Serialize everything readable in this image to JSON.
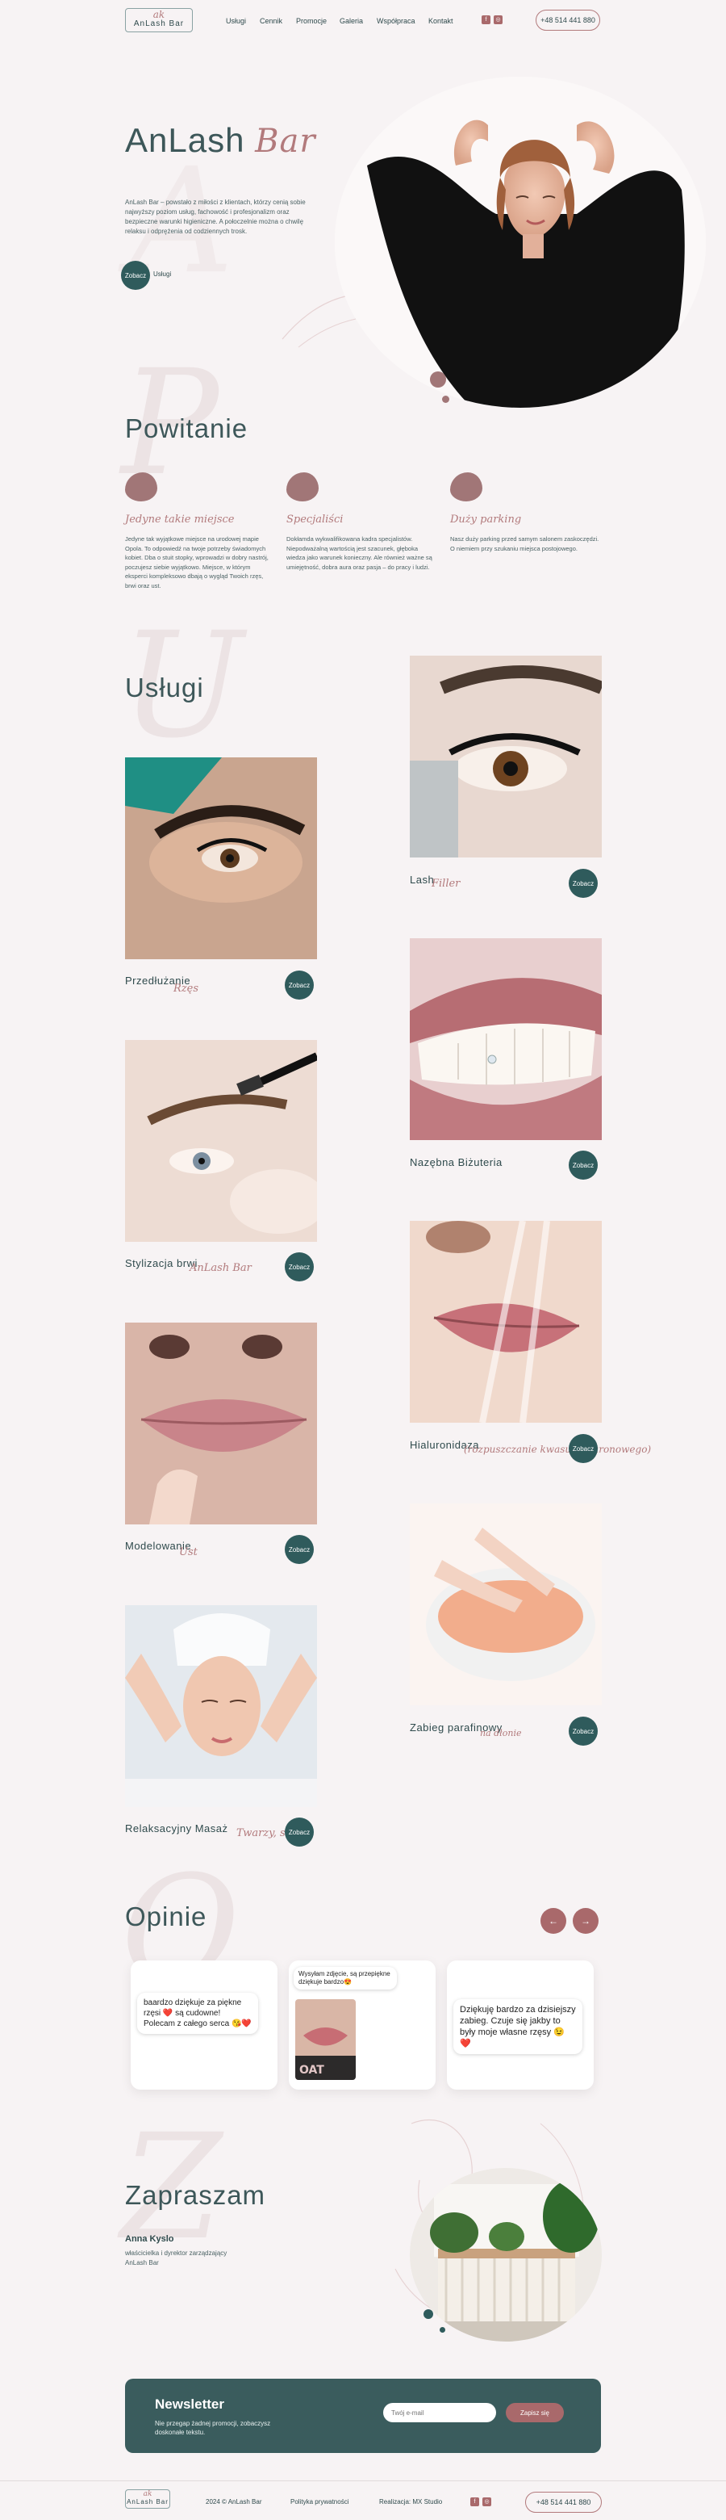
{
  "brand": {
    "mark": "ak",
    "name": "AnLash Bar"
  },
  "nav": [
    "Usługi",
    "Cennik",
    "Promocje",
    "Galeria",
    "Współpraca",
    "Kontakt"
  ],
  "social": [
    "f",
    "◎"
  ],
  "phone": "+48 514 441 880",
  "hero": {
    "title_main": "AnLash",
    "title_script": "Bar",
    "text": "AnLash Bar – powstało z miłości z klientach, którzy cenią sobie najwyższy poziom usług, fachowość i profesjonalizm oraz bezpieczne warunki higieniczne. A połoczelnie można o chwilę relaksu i odprężenia od codziennych trosk.",
    "cta": "Zobacz",
    "cta_label": "Usługi"
  },
  "welcome": {
    "title": "Powitanie",
    "ghost": "P",
    "features": [
      {
        "title": "Jedyne takie miejsce",
        "text": "Jedyne tak wyjątkowe miejsce na urodowej mapie Opola. To odpowiedź na twoje potrzeby świadomych kobiet. Dba o stuit stopky, wprowadzi w dobry nastrój, poczujesz siebie wyjątkowo. Miejsce, w którym eksperci kompleksowo dbają o wygląd Twoich rzęs, brwi oraz ust."
      },
      {
        "title": "Specjaliści",
        "text": "Dokłamda wykwalifikowana kadra specjalistów. Niepodważalną wartością jest szacunek, głęboka wiedza jako warunek konieczny. Ale również ważne są umiejętność, dobra aura oraz pasja – do pracy i ludzi."
      },
      {
        "title": "Duży parking",
        "text": "Nasz duży parking przed samym salonem zaskoczędzi. O niemiem przy szukaniu miejsca postojowego."
      }
    ]
  },
  "services": {
    "title": "Usługi",
    "ghost": "U",
    "cta": "Zobacz",
    "items": [
      {
        "name": "Przedłużanie",
        "sub": "Rzęs"
      },
      {
        "name": "Lash",
        "sub": "Filler"
      },
      {
        "name": "Stylizacja brwi",
        "sub": "AnLash Bar"
      },
      {
        "name": "Nazębna Biżuteria",
        "sub": ""
      },
      {
        "name": "Modelowanie",
        "sub": "Ust"
      },
      {
        "name": "Hialuronidaza",
        "sub": "(rozpuszczanie kwasu hialuronowego)"
      },
      {
        "name": "Relaksacyjny Masaż",
        "sub": "Twarzy, szyi i dekoltu"
      },
      {
        "name": "Zabieg parafinowy",
        "sub": "na dłonie"
      }
    ]
  },
  "reviews": {
    "title": "Opinie",
    "ghost": "O",
    "prev": "←",
    "next": "→",
    "cards": [
      {
        "text": "baardzo dziękuje za piękne rzęsi ❤️ są cudowne! Polecam z całego serca 😘❤️"
      },
      {
        "text": "Wysyłam zdjęcie, są przepiękne dziękuje bardzo😍"
      },
      {
        "text": "Dziękuję bardzo za dzisiejszy zabieg. Czuje się jakby to były moje własne rzęsy 😉 ❤️"
      }
    ]
  },
  "invite": {
    "title": "Zapraszam",
    "ghost": "Z",
    "name": "Anna Kyslo",
    "role": "właścicielka i dyrektor zarządzający AnLash Bar"
  },
  "newsletter": {
    "title": "Newsletter",
    "text": "Nie przegap żadnej promocji, zobaczysz doskonałe tekstu.",
    "placeholder": "Twój e-mail",
    "button": "Zapisz się"
  },
  "footer": {
    "copyright": "2024 © AnLash Bar",
    "privacy": "Polityka prywatności",
    "realization": "Realizacja: MX Studio"
  }
}
